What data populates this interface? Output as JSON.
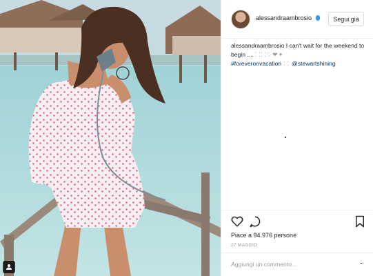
{
  "post": {
    "photo_icon": "person-tag-icon"
  },
  "header": {
    "username": "alessandraambrosio",
    "follow_label": "Segui già",
    "verified_icon": "verified-badge-icon"
  },
  "caption": {
    "username": "alessandraambrosio",
    "text": " I can't wait for the weekend to begin .... ",
    "emoji": "⸬⸬♡❤✦",
    "hashtag": "#foreveronvacation",
    "emoji2": " ⸬ ",
    "mention": "@stewartshining"
  },
  "actions": {
    "like_icon": "heart-icon",
    "comment_icon": "comment-icon",
    "save_icon": "bookmark-icon"
  },
  "likes_text": "Piace a 94.976 persone",
  "date_text": "27 MAGGIO",
  "comment_box": {
    "placeholder": "Aggiungi un commento...",
    "more_label": "..."
  },
  "colors": {
    "link": "#003569",
    "muted": "#999999",
    "border": "#efefef",
    "verified": "#3897f0"
  }
}
